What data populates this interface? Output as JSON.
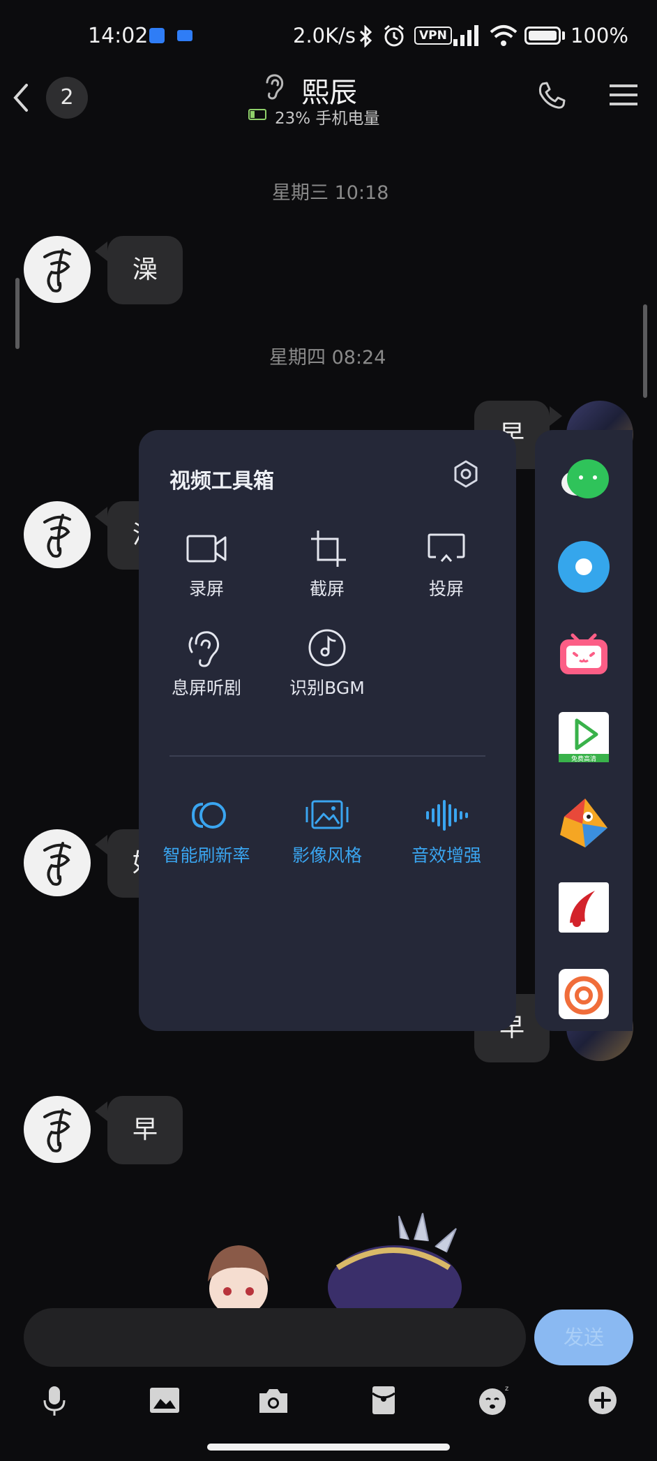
{
  "status_bar": {
    "time": "14:02",
    "net_speed": "2.0K/s",
    "vpn": "VPN",
    "battery_pct": "100%"
  },
  "header": {
    "back_count": "2",
    "contact_name": "熙辰",
    "device_battery": "23% 手机电量"
  },
  "chat": {
    "stamp_1": "星期三 10:18",
    "stamp_2": "星期四 08:24",
    "msg_1": "澡",
    "msg_2_partial": "早",
    "msg_3_partial": "没",
    "msg_4_partial": "好",
    "msg_5_partial": "早",
    "msg_6": "早"
  },
  "toolbox": {
    "title": "视频工具箱",
    "tools": [
      {
        "label": "录屏",
        "icon": "video-camera-icon"
      },
      {
        "label": "截屏",
        "icon": "crop-icon"
      },
      {
        "label": "投屏",
        "icon": "cast-icon"
      },
      {
        "label": "息屏听剧",
        "icon": "ear-icon"
      },
      {
        "label": "识别BGM",
        "icon": "music-note-icon"
      }
    ],
    "enhancements": [
      {
        "label": "智能刷新率",
        "icon": "refresh-rate-icon"
      },
      {
        "label": "影像风格",
        "icon": "image-style-icon"
      },
      {
        "label": "音效增强",
        "icon": "sound-wave-icon"
      }
    ]
  },
  "dock": {
    "apps": [
      "wechat-icon",
      "circle-app-icon",
      "bilibili-icon",
      "video-player-icon",
      "bird-app-icon",
      "red-app-icon",
      "spiral-app-icon"
    ],
    "video_app_text": "免费高清"
  },
  "composer": {
    "send_label": "发送"
  },
  "colors": {
    "accent_blue": "#3aa5f0",
    "panel_bg": "#252838",
    "bubble_bg": "#2b2b2d"
  }
}
